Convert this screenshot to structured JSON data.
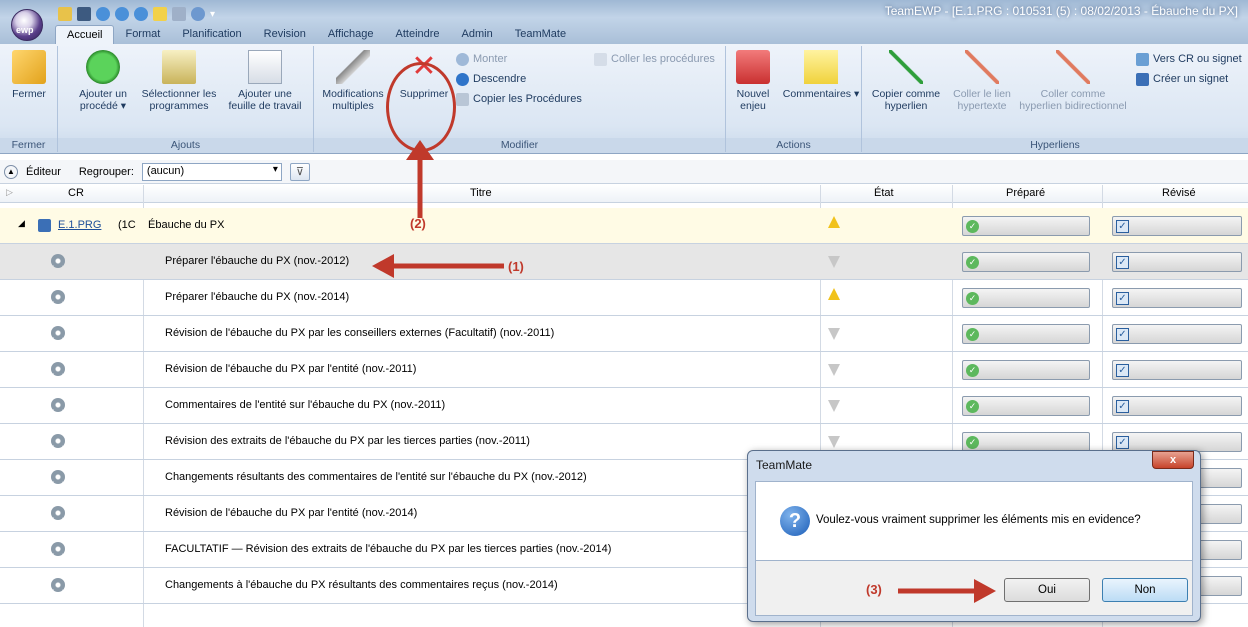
{
  "window": {
    "title": "TeamEWP - [E.1.PRG : 010531 (5) : 08/02/2013 - Ébauche du PX]",
    "orb_label": "ewp"
  },
  "tabs": [
    "Accueil",
    "Format",
    "Planification",
    "Revision",
    "Affichage",
    "Atteindre",
    "Admin",
    "TeamMate"
  ],
  "ribbon": {
    "fermer": {
      "button": "Fermer",
      "group": "Fermer"
    },
    "ajouts": {
      "b1": "Ajouter un procédé ▾",
      "b2": "Sélectionner les programmes",
      "b3": "Ajouter une feuille de travail",
      "group": "Ajouts"
    },
    "modifier": {
      "b1": "Modifications multiples",
      "b2": "Supprimer",
      "s1": "Monter",
      "s2": "Descendre",
      "s3": "Copier les Procédures",
      "s4": "Coller les procédures",
      "group": "Modifier"
    },
    "actions": {
      "b1": "Nouvel enjeu",
      "b2": "Commentaires ▾",
      "group": "Actions"
    },
    "hyperliens": {
      "b1": "Copier comme hyperlien",
      "b2": "Coller le lien hypertexte",
      "b3": "Coller comme hyperlien bidirectionnel",
      "s1": "Vers CR ou signet",
      "s2": "Créer un signet",
      "group": "Hyperliens"
    }
  },
  "editor": {
    "label": "Éditeur",
    "group_label": "Regrouper:",
    "group_value": "(aucun)"
  },
  "grid": {
    "headers": {
      "cr": "CR",
      "titre": "Titre",
      "etat": "État",
      "prepare": "Préparé",
      "revise": "Révisé"
    },
    "parent": {
      "cr": "E.1.PRG",
      "num": "(1C",
      "title": "Ébauche du PX",
      "state": "up"
    },
    "rows": [
      {
        "title": "Préparer l'ébauche du PX (nov.-2012)",
        "state": "down"
      },
      {
        "title": "Préparer l'ébauche du PX (nov.-2014)",
        "state": "up"
      },
      {
        "title": "Révision de l'ébauche du PX par les conseillers externes (Facultatif) (nov.-2011)",
        "state": "down"
      },
      {
        "title": "Révision de l'ébauche du PX par l'entité (nov.-2011)",
        "state": "down"
      },
      {
        "title": "Commentaires de l'entité sur l'ébauche du PX (nov.-2011)",
        "state": "down"
      },
      {
        "title": "Révision des extraits de l'ébauche du PX par les tierces parties (nov.-2011)",
        "state": "down"
      },
      {
        "title": "Changements résultants des commentaires de l'entité sur l'ébauche du PX (nov.-2012)",
        "state": "none"
      },
      {
        "title": "Révision de l'ébauche du PX par l'entité (nov.-2014)",
        "state": "none"
      },
      {
        "title": "FACULTATIF — Révision des extraits de l'ébauche du PX par les tierces parties (nov.-2014)",
        "state": "none"
      },
      {
        "title": "Changements à l'ébauche du PX résultants des commentaires reçus (nov.-2014)",
        "state": "none"
      }
    ]
  },
  "annotations": {
    "a1": "(1)",
    "a2": "(2)",
    "a3": "(3)"
  },
  "dialog": {
    "title": "TeamMate",
    "message": "Voulez-vous vraiment supprimer les éléments mis en evidence?",
    "yes": "Oui",
    "no": "Non",
    "close": "x"
  },
  "colors": {
    "accent": "#c0392b",
    "ribbon": "#dbe6f3",
    "parent_row": "#fffbe5",
    "selected_row": "#e6e6e6"
  }
}
